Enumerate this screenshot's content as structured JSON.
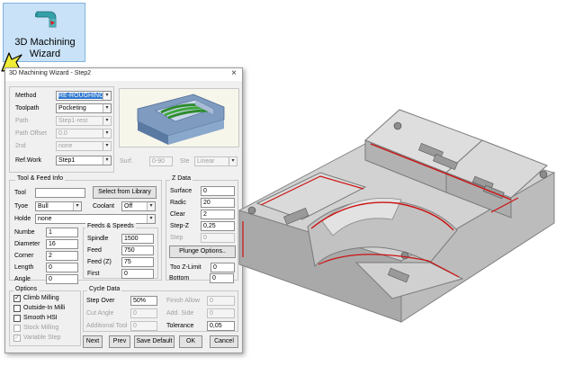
{
  "ribbon": {
    "label_line1": "3D Machining",
    "label_line2": "Wizard",
    "icon": "machining-wizard-icon",
    "cursor_icon": "pointer-cursor-icon"
  },
  "dialog": {
    "title": "3D Machining Wizard - Step2",
    "close": "×",
    "method": {
      "fields": [
        {
          "label": "Method",
          "value": "RE-ROUGHING",
          "enabled": true
        },
        {
          "label": "Toolpath",
          "value": "Pocketing",
          "enabled": true
        },
        {
          "label": "Path",
          "value": "Step1-rest",
          "enabled": false
        },
        {
          "label": "Path Offset",
          "value": "0.0",
          "enabled": false
        },
        {
          "label": "2nd",
          "value": "none",
          "enabled": false
        },
        {
          "label": "Ref.Work",
          "value": "Step1",
          "enabled": true
        }
      ],
      "surf_label": "Surf.",
      "surf_value": "0-90",
      "step_label": "Ste",
      "step_value": "Linear"
    },
    "tool": {
      "title": "Tool & Feed Info",
      "tool_label": "Tool",
      "tool_value": "",
      "select_library": "Select from Library",
      "type_label": "Tyoe",
      "type_value": "Bull",
      "coolant_label": "Coolant",
      "coolant_value": "Off",
      "holder_label": "Holde",
      "holder_value": "none",
      "params": [
        {
          "label": "Numbe",
          "value": "1"
        },
        {
          "label": "Diameter",
          "value": "16"
        },
        {
          "label": "Corner",
          "value": "2"
        },
        {
          "label": "Length",
          "value": "0"
        },
        {
          "label": "Angle",
          "value": "0"
        }
      ]
    },
    "feeds": {
      "title": "Feeds & Speeds",
      "items": [
        {
          "label": "Spindle",
          "value": "1500"
        },
        {
          "label": "Feed",
          "value": "750"
        },
        {
          "label": "Feed (Z)",
          "value": "75"
        },
        {
          "label": "First",
          "value": "0"
        }
      ]
    },
    "zdata": {
      "title": "Z Data",
      "items": [
        {
          "label": "Surface",
          "value": "0",
          "enabled": true
        },
        {
          "label": "Radic",
          "value": "20",
          "enabled": true
        },
        {
          "label": "Clear",
          "value": "2",
          "enabled": true
        },
        {
          "label": "Step-Z",
          "value": "0,25",
          "enabled": true
        },
        {
          "label": "Step",
          "value": "0",
          "enabled": false
        }
      ],
      "plunge": "Plunge Options..",
      "zlimit_label": "Too Z-Limit",
      "zlimit_value": "0",
      "bottom_label": "Bottom",
      "bottom_value": "0"
    },
    "options": {
      "title": "Options",
      "items": [
        {
          "label": "Climb Milling",
          "checked": true,
          "enabled": true
        },
        {
          "label": "Outside-In Milli",
          "checked": false,
          "enabled": true
        },
        {
          "label": "Smooth HSI",
          "checked": false,
          "enabled": true
        },
        {
          "label": "Stock Milling",
          "checked": false,
          "enabled": false
        },
        {
          "label": "Variable Step",
          "checked": true,
          "enabled": false
        }
      ]
    },
    "cycle": {
      "title": "Cycle Data",
      "left": [
        {
          "label": "Step Over",
          "value": "50%",
          "enabled": true
        },
        {
          "label": "Cut Angle",
          "value": "0",
          "enabled": false
        },
        {
          "label": "Additional Tool",
          "value": "0",
          "enabled": false
        }
      ],
      "right": [
        {
          "label": "Finish Allow",
          "value": "0",
          "enabled": false
        },
        {
          "label": "Add. Side",
          "value": "0",
          "enabled": false
        },
        {
          "label": "Tolerance",
          "value": "0,05",
          "enabled": true
        }
      ]
    },
    "buttons": {
      "next": "Next",
      "prev": "Prev",
      "save_default": "Save Default",
      "ok": "OK",
      "cancel": "Cancel"
    }
  },
  "colors": {
    "tile_bg": "#c9e2f7",
    "accent_teal": "#36a0a8",
    "selection": "#3078d0",
    "toolpath_red": "#cc1111",
    "part_gray": "#c9c9c9",
    "cursor_yellow": "#f2ee38"
  }
}
